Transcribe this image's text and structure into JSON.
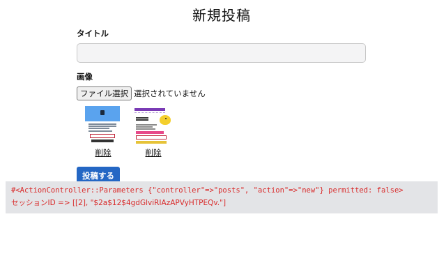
{
  "page": {
    "title": "新規投稿"
  },
  "form": {
    "title_label": "タイトル",
    "title_value": "",
    "title_placeholder": "",
    "image_label": "画像",
    "file_button_label": "ファイル選択",
    "file_status": "選択されていません",
    "images": [
      {
        "delete_label": "削除"
      },
      {
        "delete_label": "削除"
      }
    ],
    "submit_label": "投稿する"
  },
  "debug": {
    "params_text": "#<ActionController::Parameters {\"controller\"=>\"posts\", \"action\"=>\"new\"} permitted: false>",
    "session_text": "セッションID => [[2], \"$2a$12$4gdGlviRIAzAPVyHTPEQv.\"]",
    "text_color": "#d92b2b",
    "background_color": "#e3e4e7"
  },
  "colors": {
    "primary_button": "#2467c4"
  }
}
